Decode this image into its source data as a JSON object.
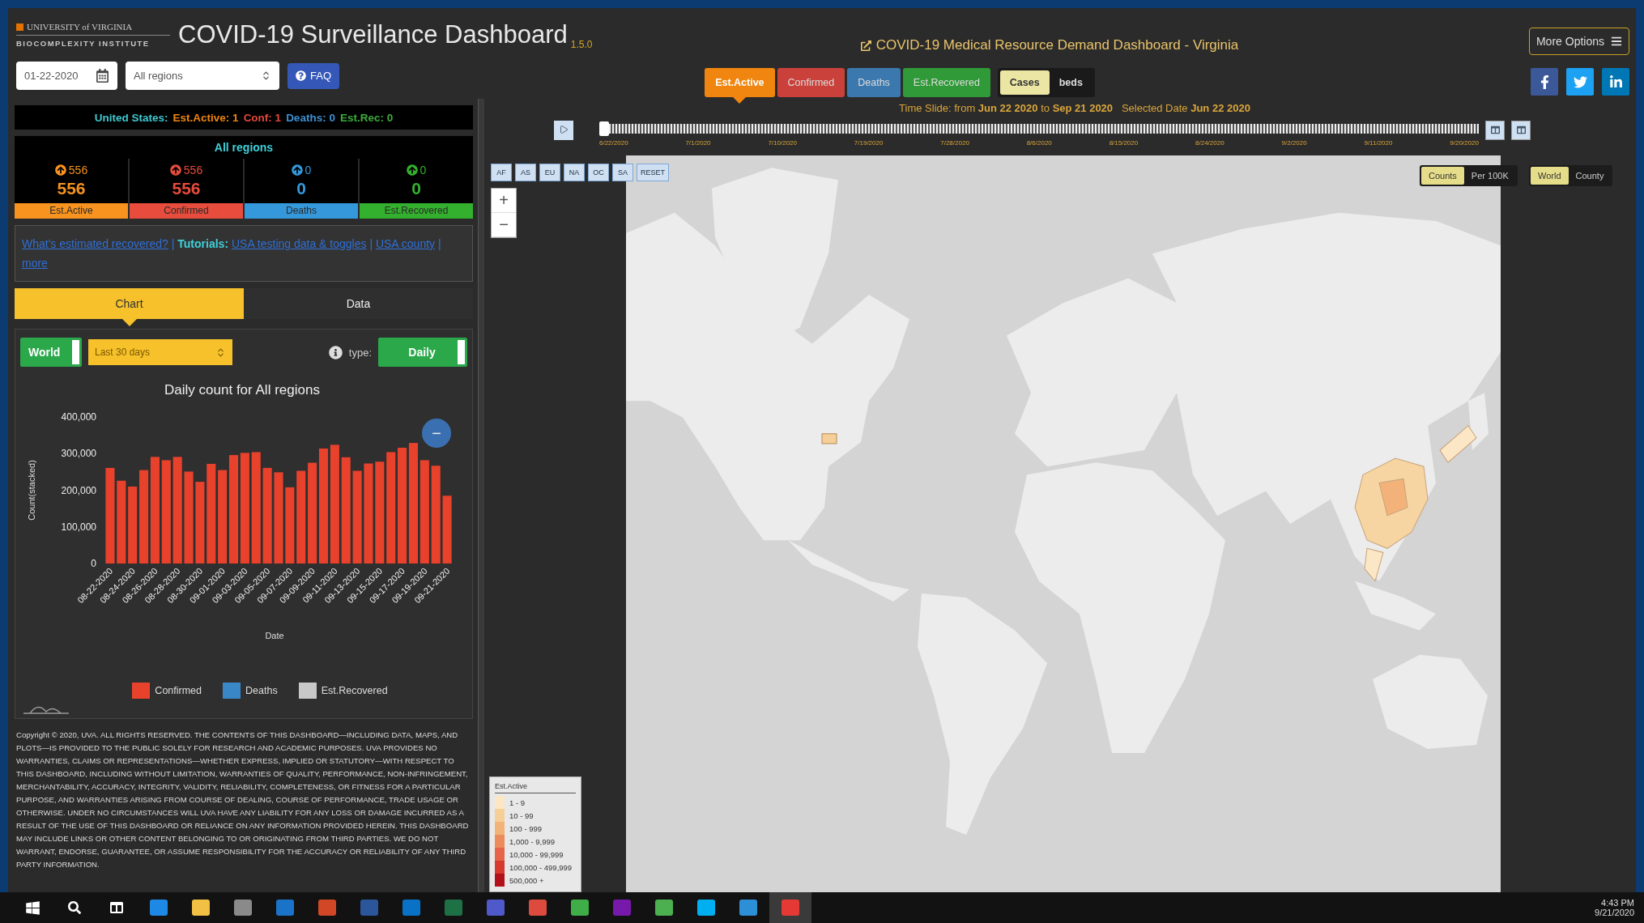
{
  "header": {
    "logo": {
      "line1": "UNIVERSITY of VIRGINIA",
      "line2": "BIOCOMPLEXITY INSTITUTE"
    },
    "title": "COVID-19 Surveillance Dashboard",
    "version": "1.5.0",
    "date_field": {
      "value": "01-22-2020"
    },
    "region_select": {
      "value": "All regions"
    },
    "faq_button": "FAQ",
    "resource_link": "COVID-19 Medical Resource Demand Dashboard - Virginia",
    "metric_tabs": [
      {
        "label": "Est.Active",
        "selected": true,
        "color": "#f0860f"
      },
      {
        "label": "Confirmed",
        "selected": false,
        "color": "#c9413a"
      },
      {
        "label": "Deaths",
        "selected": false,
        "color": "#3b78ad"
      },
      {
        "label": "Est.Recovered",
        "selected": false,
        "color": "#2f9a37"
      }
    ],
    "mode_toggle": [
      {
        "label": "Cases",
        "selected": true
      },
      {
        "label": "beds",
        "selected": false
      }
    ],
    "more_options": "More Options",
    "social": [
      {
        "kind": "facebook"
      },
      {
        "kind": "twitter"
      },
      {
        "kind": "linkedin"
      }
    ]
  },
  "left_panel": {
    "summary": [
      {
        "text": "United States:",
        "color": "#3fc8cf"
      },
      {
        "text": "Est.Active: 1",
        "color": "#f0860f"
      },
      {
        "text": "Conf: 1",
        "color": "#e2493d"
      },
      {
        "text": "Deaths: 0",
        "color": "#3d8fd1"
      },
      {
        "text": "Est.Rec: 0",
        "color": "#3cab3c"
      }
    ],
    "region_heading": "All regions",
    "stats": [
      {
        "label": "Est.Active",
        "change": "556",
        "value": "556",
        "color": "#f7931e"
      },
      {
        "label": "Confirmed",
        "change": "556",
        "value": "556",
        "color": "#e74c3c"
      },
      {
        "label": "Deaths",
        "change": "0",
        "value": "0",
        "color": "#3498db"
      },
      {
        "label": "Est.Recovered",
        "change": "0",
        "value": "0",
        "color": "#33b02d"
      }
    ],
    "info_links": [
      {
        "kind": "link",
        "text": "What's estimated recovered?"
      },
      {
        "kind": "sep",
        "text": "|"
      },
      {
        "kind": "label",
        "text": "Tutorials:"
      },
      {
        "kind": "link",
        "text": "USA testing data & toggles"
      },
      {
        "kind": "sep",
        "text": "|"
      },
      {
        "kind": "link",
        "text": "USA county"
      },
      {
        "kind": "sep",
        "text": "|"
      },
      {
        "kind": "link",
        "text": "more"
      }
    ],
    "view_tabs": [
      {
        "label": "Chart",
        "selected": true
      },
      {
        "label": "Data",
        "selected": false
      }
    ],
    "chart_controls": {
      "scope_toggle": {
        "label": "World",
        "on": true
      },
      "range_select": {
        "value": "Last 30 days"
      },
      "type_label": "type:",
      "type_toggle": {
        "label": "Daily",
        "on": true
      }
    },
    "collapse_button": "−",
    "chart_data": {
      "type": "bar",
      "title": "Daily count for All regions",
      "xlabel": "Date",
      "ylabel": "Count(stacked)",
      "categories": [
        "08-22-2020",
        null,
        "08-24-2020",
        null,
        "08-26-2020",
        null,
        "08-28-2020",
        null,
        "08-30-2020",
        null,
        "09-01-2020",
        null,
        "09-03-2020",
        null,
        "09-05-2020",
        null,
        "09-07-2020",
        null,
        "09-09-2020",
        null,
        "09-11-2020",
        null,
        "09-13-2020",
        null,
        "09-15-2020",
        null,
        "09-17-2020",
        null,
        "09-19-2020",
        null,
        "09-21-2020"
      ],
      "series": [
        {
          "name": "Confirmed",
          "color": "#e8412c",
          "values": [
            261000,
            226000,
            210000,
            255000,
            291000,
            282000,
            291000,
            251000,
            223000,
            272000,
            255000,
            296000,
            302000,
            304000,
            261000,
            249000,
            208000,
            253000,
            275000,
            314000,
            324000,
            290000,
            253000,
            273000,
            278000,
            304000,
            316000,
            329000,
            282000,
            267000,
            185000
          ]
        }
      ],
      "ylim": [
        0,
        400000
      ],
      "yticks": [
        {
          "value": 0,
          "label": "0"
        },
        {
          "value": 100000,
          "label": "100,000"
        },
        {
          "value": 200000,
          "label": "200,000"
        },
        {
          "value": 300000,
          "label": "300,000"
        },
        {
          "value": 400000,
          "label": "400,000"
        }
      ]
    },
    "chart_legend": [
      {
        "label": "Deaths",
        "color": "#3a87c8"
      },
      {
        "label": "Est.Recovered",
        "color": "#c8c8c8"
      }
    ],
    "copyright": "Copyright © 2020, UVA. ALL RIGHTS RESERVED. THE CONTENTS OF THIS DASHBOARD—INCLUDING DATA, MAPS, AND PLOTS—IS PROVIDED TO THE PUBLIC SOLELY FOR RESEARCH AND ACADEMIC PURPOSES. UVA PROVIDES NO WARRANTIES, CLAIMS OR REPRESENTATIONS—WHETHER EXPRESS, IMPLIED OR STATUTORY—WITH RESPECT TO THIS DASHBOARD, INCLUDING WITHOUT LIMITATION, WARRANTIES OF QUALITY, PERFORMANCE, NON-INFRINGEMENT, MERCHANTABILITY, ACCURACY, INTEGRITY, VALIDITY, RELIABILITY, COMPLETENESS, OR FITNESS FOR A PARTICULAR PURPOSE, AND WARRANTIES ARISING FROM COURSE OF DEALING, COURSE OF PERFORMANCE, TRADE USAGE OR OTHERWISE. UNDER NO CIRCUMSTANCES WILL UVA HAVE ANY LIABILITY FOR ANY LOSS OR DAMAGE INCURRED AS A RESULT OF THE USE OF THIS DASHBOARD OR RELIANCE ON ANY INFORMATION PROVIDED HEREIN. THIS DASHBOARD MAY INCLUDE LINKS OR OTHER CONTENT BELONGING TO OR ORIGINATING FROM THIRD PARTIES. WE DO NOT WARRANT, ENDORSE, GUARANTEE, OR ASSUME RESPONSIBILITY FOR THE ACCURACY OR RELIABILITY OF ANY THIRD PARTY INFORMATION."
  },
  "timeline": {
    "caption": "Time Slide: from **Jun 22 2020** to **Sep 21 2020**   Selected Date **Jun 22 2020**",
    "level": 0,
    "ticks": [
      "6/22/2020",
      "7/1/2020",
      "7/10/2020",
      "7/19/2020",
      "7/28/2020",
      "8/6/2020",
      "8/15/2020",
      "8/24/2020",
      "9/2/2020",
      "9/11/2020",
      "9/20/2020"
    ]
  },
  "map": {
    "region_buttons": [
      "AF",
      "AS",
      "EU",
      "NA",
      "OC",
      "SA",
      "RESET"
    ],
    "zoom_in": "+",
    "zoom_out": "−",
    "measure_toggle": [
      {
        "label": "Counts",
        "selected": true
      },
      {
        "label": "Per 100K",
        "selected": false
      }
    ],
    "scope_toggle": [
      {
        "label": "World",
        "selected": true
      },
      {
        "label": "County",
        "selected": false
      }
    ],
    "legend": {
      "title": "Est.Active",
      "items": [
        {
          "label": "1 - 9",
          "color": "#fbe7c6"
        },
        {
          "label": "10 - 99",
          "color": "#f6cf98"
        },
        {
          "label": "100 - 999",
          "color": "#f2b27a"
        },
        {
          "label": "1,000 - 9,999",
          "color": "#ec8c5c"
        },
        {
          "label": "10,000 - 99,999",
          "color": "#e5644a"
        },
        {
          "label": "100,000 - 499,999",
          "color": "#d63a2e"
        },
        {
          "label": "500,000 +",
          "color": "#b3111a"
        }
      ]
    }
  },
  "taskbar": {
    "apps": [
      {
        "kind": "windows"
      },
      {
        "kind": "search"
      },
      {
        "kind": "tasks"
      },
      {
        "kind": "tile",
        "color": "#1e88e5",
        "selected": false
      },
      {
        "kind": "tile",
        "color": "#f2c043",
        "selected": false
      },
      {
        "kind": "tile",
        "color": "#8a8a8a",
        "selected": false
      },
      {
        "kind": "tile",
        "color": "#1a73c9",
        "selected": false
      },
      {
        "kind": "tile",
        "color": "#d24726",
        "selected": false
      },
      {
        "kind": "tile",
        "color": "#2b579a",
        "selected": false
      },
      {
        "kind": "tile",
        "color": "#0a72c6",
        "selected": false
      },
      {
        "kind": "tile",
        "color": "#1e7145",
        "selected": false
      },
      {
        "kind": "tile",
        "color": "#5059c9",
        "selected": false
      },
      {
        "kind": "tile",
        "color": "#dd4b3e",
        "selected": false
      },
      {
        "kind": "tile",
        "color": "#3fae49",
        "selected": false
      },
      {
        "kind": "tile",
        "color": "#7719aa",
        "selected": false
      },
      {
        "kind": "tile",
        "color": "#4caf50",
        "selected": false
      },
      {
        "kind": "tile",
        "color": "#00aff0",
        "selected": false
      },
      {
        "kind": "tile",
        "color": "#2d8fd5",
        "selected": false
      },
      {
        "kind": "tile",
        "color": "#e53935",
        "selected": true
      }
    ],
    "time": "4:43 PM",
    "date": "9/21/2020"
  }
}
